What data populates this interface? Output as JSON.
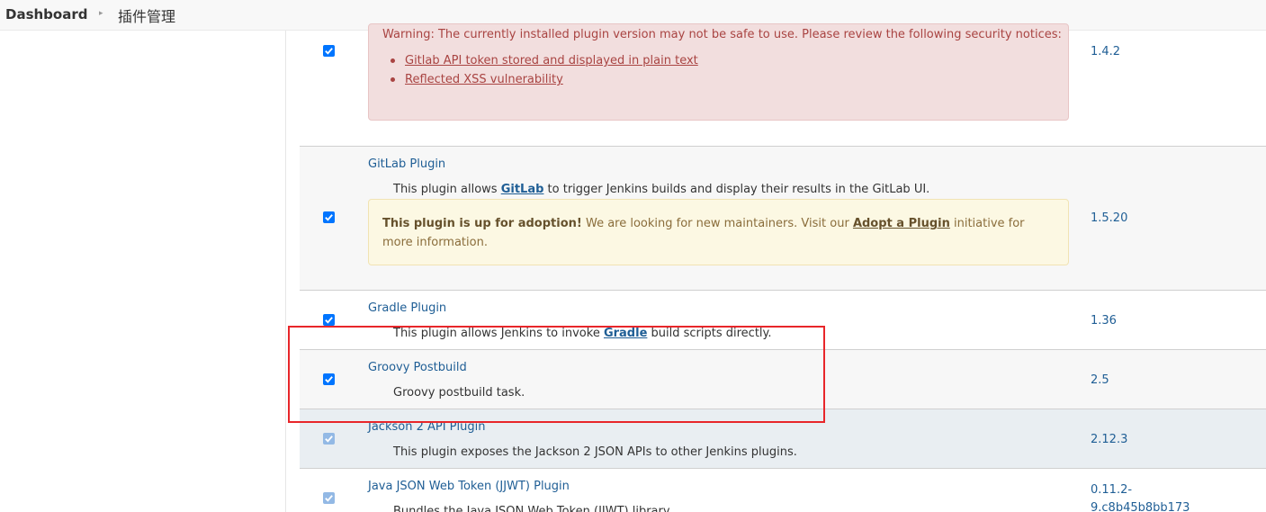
{
  "breadcrumb": {
    "home": "Dashboard",
    "separator": "▸",
    "current": "插件管理"
  },
  "plugins": [
    {
      "name": "",
      "version": "1.4.2",
      "checked": true,
      "warning": {
        "message": "Warning: The currently installed plugin version may not be safe to use. Please review the following security notices:",
        "links": [
          "Gitlab API token stored and displayed in plain text",
          "Reflected XSS vulnerability"
        ]
      }
    },
    {
      "name": "GitLab Plugin",
      "version": "1.5.20",
      "checked": true,
      "desc_pre": "This plugin allows ",
      "desc_link": "GitLab",
      "desc_post": " to trigger Jenkins builds and display their results in the GitLab UI.",
      "adoption": {
        "bold": "This plugin is up for adoption!",
        "text_pre": " We are looking for new maintainers. Visit our ",
        "link": "Adopt a Plugin",
        "text_post": " initiative for more information."
      }
    },
    {
      "name": "Gradle Plugin",
      "version": "1.36",
      "checked": true,
      "desc_pre": "This plugin allows Jenkins to invoke ",
      "desc_link": "Gradle",
      "desc_post": " build scripts directly."
    },
    {
      "name": "Groovy Postbuild",
      "version": "2.5",
      "checked": true,
      "desc": "Groovy postbuild task."
    },
    {
      "name": "Jackson 2 API Plugin",
      "version": "2.12.3",
      "checked": true,
      "disabled": true,
      "desc": "This plugin exposes the Jackson 2 JSON APIs to other Jenkins plugins."
    },
    {
      "name": "Java JSON Web Token (JJWT) Plugin",
      "version_line1": "0.11.2-",
      "version_line2": "9.c8b45b8bb173",
      "checked": true,
      "disabled": true,
      "desc": "Bundles the Java JSON Web Token (JJWT) library."
    }
  ],
  "colors": {
    "link": "#1f5e95",
    "checkbox": "#0075ff",
    "highlight": "#e8262a",
    "danger_bg": "#f2dede",
    "warn_bg": "#fcf8e3"
  }
}
